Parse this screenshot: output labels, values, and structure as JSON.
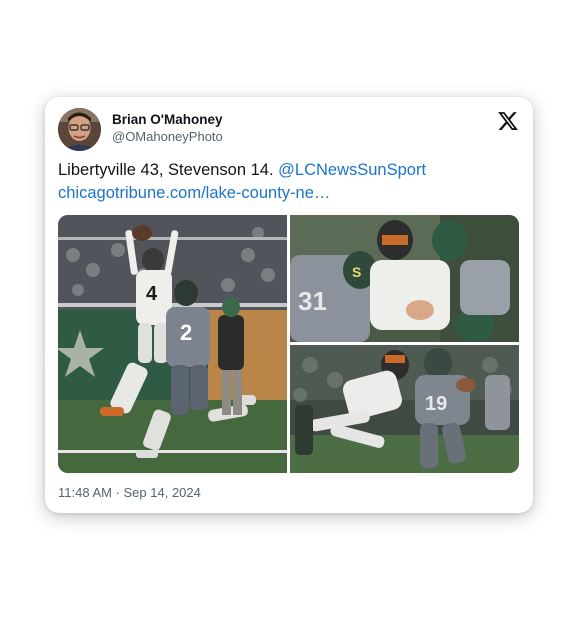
{
  "tweet": {
    "author": {
      "display_name": "Brian O'Mahoney",
      "handle": "@OMahoneyPhoto"
    },
    "text_main": "Libertyville 43, Stevenson 14. ",
    "mention": "@LCNewsSunSport",
    "link": "chicagotribune.com/lake-county-ne…",
    "timestamp": "11:48 AM · Sep 14, 2024",
    "media_count": 3
  },
  "icons": {
    "platform": "x-logo-icon",
    "avatar": "profile-photo"
  },
  "colors": {
    "link": "#1d74c8",
    "text": "#0f1419",
    "secondary": "#536471"
  }
}
